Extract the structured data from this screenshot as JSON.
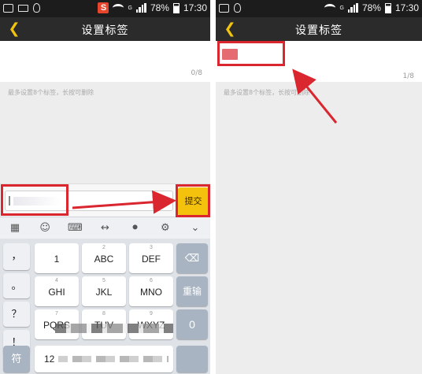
{
  "screens": [
    {
      "status": {
        "battery": "78%",
        "time": "17:30",
        "signal_label": "G",
        "app_badge": "S"
      },
      "title": "设置标签",
      "counter": "0/8",
      "hint": "最多设置8个标签，长按可删除",
      "submit": "提交"
    },
    {
      "status": {
        "battery": "78%",
        "time": "17:30",
        "signal_label": "G"
      },
      "title": "设置标签",
      "counter": "1/8",
      "hint": "最多设置8个标签，长按可删除"
    }
  ],
  "keyboard": {
    "side_keys": [
      "，",
      "。",
      "？",
      "！"
    ],
    "row1": [
      {
        "num": "",
        "label": "1"
      },
      {
        "num": "2",
        "label": "ABC"
      },
      {
        "num": "3",
        "label": "DEF"
      }
    ],
    "row2": [
      {
        "num": "4",
        "label": "GHI"
      },
      {
        "num": "5",
        "label": "JKL"
      },
      {
        "num": "6",
        "label": "MNO"
      }
    ],
    "row3": [
      {
        "num": "7",
        "label": "PQRS"
      },
      {
        "num": "8",
        "label": "TUV"
      },
      {
        "num": "9",
        "label": "WXYZ"
      }
    ],
    "retype": "重输",
    "symbols": "符",
    "zero": "0",
    "space_num": "12"
  },
  "icons": {
    "back": "chevron-left-icon",
    "delete": "backspace-icon",
    "mic": "microphone-icon",
    "settings": "gear-icon"
  },
  "colors": {
    "accent": "#f4c20d",
    "highlight": "#d9262f",
    "titlebar": "#2b2b2b"
  }
}
